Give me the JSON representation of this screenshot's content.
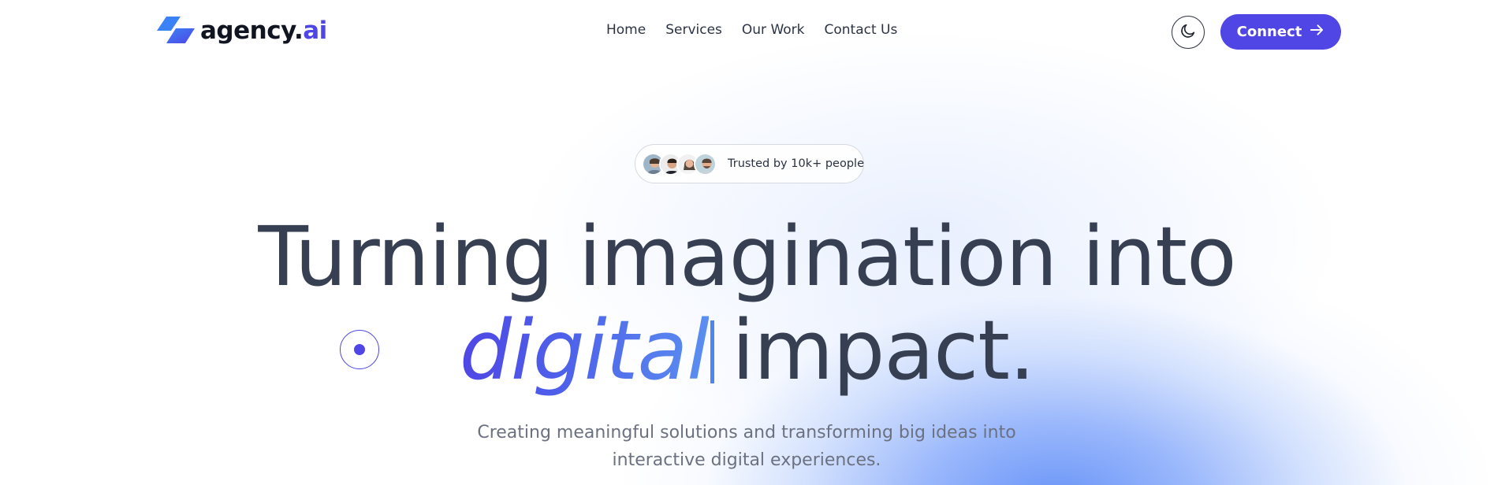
{
  "brand": {
    "name": "agency.",
    "accent": "ai",
    "accent_color": "#4f46e5",
    "icon": "parallelogram-logo-icon"
  },
  "nav": {
    "items": [
      "Home",
      "Services",
      "Our Work",
      "Contact Us"
    ]
  },
  "header": {
    "theme_toggle_icon": "moon-icon",
    "connect_label": "Connect",
    "connect_icon": "arrow-right-icon",
    "connect_color": "#4f46e5"
  },
  "trust": {
    "label": "Trusted by 10k+ people",
    "avatar_count": 4
  },
  "hero": {
    "line1": "Turning imagination into",
    "highlight": "digital",
    "line2_rest": "impact.",
    "subtitle_line1": "Creating meaningful solutions and transforming big ideas into",
    "subtitle_line2": "interactive digital experiences."
  },
  "colors": {
    "heading": "#374053",
    "glow": "#608ef7",
    "body_text": "#6b7180"
  }
}
